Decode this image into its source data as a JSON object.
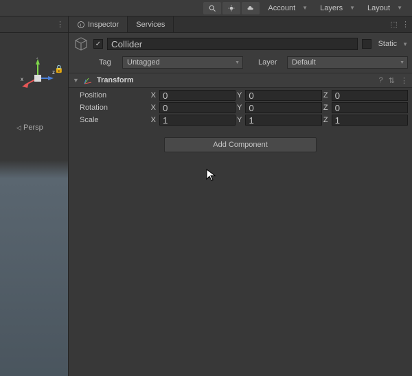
{
  "toolbar": {
    "account": "Account",
    "layers": "Layers",
    "layout": "Layout"
  },
  "tabs": {
    "inspector": "Inspector",
    "services": "Services"
  },
  "header": {
    "name": "Collider",
    "static_label": "Static",
    "checked": true
  },
  "tag": {
    "label": "Tag",
    "value": "Untagged",
    "layer_label": "Layer",
    "layer_value": "Default"
  },
  "transform": {
    "title": "Transform",
    "rows": {
      "position": {
        "label": "Position",
        "x": "0",
        "y": "0",
        "z": "0"
      },
      "rotation": {
        "label": "Rotation",
        "x": "0",
        "y": "0",
        "z": "0"
      },
      "scale": {
        "label": "Scale",
        "x": "1",
        "y": "1",
        "z": "1"
      }
    },
    "axis": {
      "x": "X",
      "y": "Y",
      "z": "Z"
    }
  },
  "add_component": "Add Component",
  "scene": {
    "axis": {
      "x": "x",
      "y": "y",
      "z": "z"
    },
    "persp": "Persp"
  }
}
